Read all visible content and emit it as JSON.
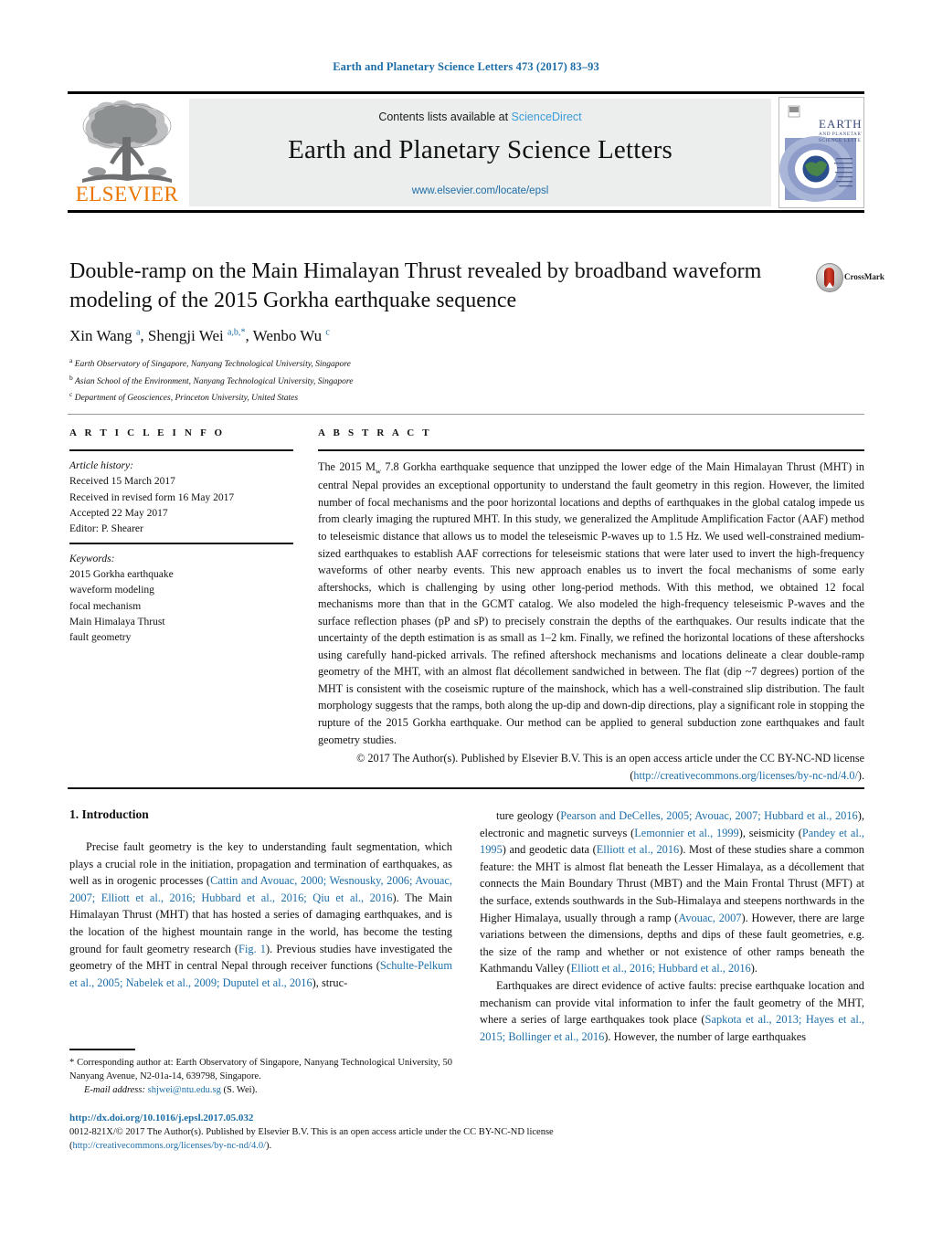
{
  "running_head": "Earth and Planetary Science Letters 473 (2017) 83–93",
  "masthead": {
    "publisher_name": "ELSEVIER",
    "contents_prefix": "Contents lists available at ",
    "sciencedirect": "ScienceDirect",
    "journal_title": "Earth and Planetary Science Letters",
    "journal_url": "www.elsevier.com/locate/epsl",
    "cover_title_line1": "EARTH",
    "cover_title_line2": "AND PLANETARY",
    "cover_title_line3": "SCIENCE LETTERS"
  },
  "article": {
    "title": "Double-ramp on the Main Himalayan Thrust revealed by broadband waveform modeling of the 2015 Gorkha earthquake sequence",
    "authors_html": "Xin Wang <sup>a</sup>, Shengji Wei <sup>a,b,</sup><sup>*</sup>, Wenbo Wu <sup>c</sup>",
    "affiliations": [
      {
        "marker": "a",
        "text": "Earth Observatory of Singapore, Nanyang Technological University, Singapore"
      },
      {
        "marker": "b",
        "text": "Asian School of the Environment, Nanyang Technological University, Singapore"
      },
      {
        "marker": "c",
        "text": "Department of Geosciences, Princeton University, United States"
      }
    ],
    "crossmark_label": "CrossMark"
  },
  "info": {
    "heading": "A R T I C L E   I N F O",
    "history_label": "Article history:",
    "history": [
      "Received 15 March 2017",
      "Received in revised form 16 May 2017",
      "Accepted 22 May 2017",
      "Editor: P. Shearer"
    ],
    "keywords_label": "Keywords:",
    "keywords": [
      "2015 Gorkha earthquake",
      "waveform modeling",
      "focal mechanism",
      "Main Himalaya Thrust",
      "fault geometry"
    ]
  },
  "abstract": {
    "heading": "A B S T R A C T",
    "text_part1": "The 2015 M",
    "text_sub": "w",
    "text_part2": " 7.8 Gorkha earthquake sequence that unzipped the lower edge of the Main Himalayan Thrust (MHT) in central Nepal provides an exceptional opportunity to understand the fault geometry in this region. However, the limited number of focal mechanisms and the poor horizontal locations and depths of earthquakes in the global catalog impede us from clearly imaging the ruptured MHT. In this study, we generalized the Amplitude Amplification Factor (AAF) method to teleseismic distance that allows us to model the teleseismic P-waves up to 1.5 Hz. We used well-constrained medium-sized earthquakes to establish AAF corrections for teleseismic stations that were later used to invert the high-frequency waveforms of other nearby events. This new approach enables us to invert the focal mechanisms of some early aftershocks, which is challenging by using other long-period methods. With this method, we obtained 12 focal mechanisms more than that in the GCMT catalog. We also modeled the high-frequency teleseismic P-waves and the surface reflection phases (pP and sP) to precisely constrain the depths of the earthquakes. Our results indicate that the uncertainty of the depth estimation is as small as 1–2 km. Finally, we refined the horizontal locations of these aftershocks using carefully hand-picked arrivals. The refined aftershock mechanisms and locations delineate a clear double-ramp geometry of the MHT, with an almost flat décollement sandwiched in between. The flat (dip ~7 degrees) portion of the MHT is consistent with the coseismic rupture of the mainshock, which has a well-constrained slip distribution. The fault morphology suggests that the ramps, both along the up-dip and down-dip directions, play a significant role in stopping the rupture of the 2015 Gorkha earthquake. Our method can be applied to general subduction zone earthquakes and fault geometry studies.",
    "copyright_prefix": "© 2017 The Author(s). Published by Elsevier B.V. This is an open access article under the CC BY-NC-ND license (",
    "copyright_link": "http://creativecommons.org/licenses/by-nc-nd/4.0/",
    "copyright_suffix": ")."
  },
  "body": {
    "section_heading": "1. Introduction",
    "left_paragraphs": [
      {
        "segments": [
          {
            "t": "Precise fault geometry is the key to understanding fault segmentation, which plays a crucial role in the initiation, propagation and termination of earthquakes, as well as in orogenic processes (",
            "link": false
          },
          {
            "t": "Cattin and Avouac, 2000; Wesnousky, 2006; Avouac, 2007; Elliott et al., 2016; Hubbard et al., 2016; Qiu et al., 2016",
            "link": true
          },
          {
            "t": "). The Main Himalayan Thrust (MHT) that has hosted a series of damaging earthquakes, and is the location of the highest mountain range in the world, has become the testing ground for fault geometry research (",
            "link": false
          },
          {
            "t": "Fig. 1",
            "link": true
          },
          {
            "t": "). Previous studies have investigated the geometry of the MHT in central Nepal through receiver functions (",
            "link": false
          },
          {
            "t": "Schulte-Pelkum et al., 2005; Nabelek et al., 2009; Duputel et al., 2016",
            "link": true
          },
          {
            "t": "), struc-",
            "link": false
          }
        ]
      }
    ],
    "right_paragraphs": [
      {
        "segments": [
          {
            "t": "ture geology (",
            "link": false
          },
          {
            "t": "Pearson and DeCelles, 2005; Avouac, 2007; Hubbard et al., 2016",
            "link": true
          },
          {
            "t": "), electronic and magnetic surveys (",
            "link": false
          },
          {
            "t": "Lemonnier et al., 1999",
            "link": true
          },
          {
            "t": "), seismicity (",
            "link": false
          },
          {
            "t": "Pandey et al., 1995",
            "link": true
          },
          {
            "t": ") and geodetic data (",
            "link": false
          },
          {
            "t": "Elliott et al., 2016",
            "link": true
          },
          {
            "t": "). Most of these studies share a common feature: the MHT is almost flat beneath the Lesser Himalaya, as a décollement that connects the Main Boundary Thrust (MBT) and the Main Frontal Thrust (MFT) at the surface, extends southwards in the Sub-Himalaya and steepens northwards in the Higher Himalaya, usually through a ramp (",
            "link": false
          },
          {
            "t": "Avouac, 2007",
            "link": true
          },
          {
            "t": "). However, there are large variations between the dimensions, depths and dips of these fault geometries, e.g. the size of the ramp and whether or not existence of other ramps beneath the Kathmandu Valley (",
            "link": false
          },
          {
            "t": "Elliott et al., 2016; Hubbard et al., 2016",
            "link": true
          },
          {
            "t": ").",
            "link": false
          }
        ]
      },
      {
        "segments": [
          {
            "t": "Earthquakes are direct evidence of active faults: precise earthquake location and mechanism can provide vital information to infer the fault geometry of the MHT, where a series of large earthquakes took place (",
            "link": false
          },
          {
            "t": "Sapkota et al., 2013; Hayes et al., 2015; Bollinger et al., 2016",
            "link": true
          },
          {
            "t": "). However, the number of large earthquakes",
            "link": false
          }
        ]
      }
    ]
  },
  "footnote": {
    "marker": "*",
    "corresponding": "Corresponding author at: Earth Observatory of Singapore, Nanyang Technological University, 50 Nanyang Avenue, N2-01a-14, 639798, Singapore.",
    "email_label": "E-mail address:",
    "email": "shjwei@ntu.edu.sg",
    "email_suffix": "(S. Wei)."
  },
  "bottom": {
    "doi": "http://dx.doi.org/10.1016/j.epsl.2017.05.032",
    "issn_prefix": "0012-821X/© 2017 The Author(s). Published by Elsevier B.V. This is an open access article under the CC BY-NC-ND license (",
    "issn_link": "http://creativecommons.org/licenses/by-nc-nd/4.0/",
    "issn_suffix": ")."
  },
  "colors": {
    "link": "#1d6ea8",
    "sciencedirect": "#3b9cd9",
    "elsevier_orange": "#ea7600",
    "banner_bg": "#eceded"
  }
}
